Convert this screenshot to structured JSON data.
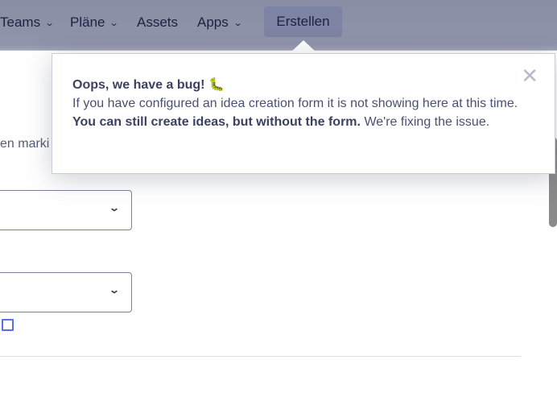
{
  "nav": {
    "items": [
      {
        "label": "Teams",
        "chevron": "chevron-down-icon"
      },
      {
        "label": "Pläne",
        "chevron": "chevron-down-icon"
      },
      {
        "label": "Assets"
      },
      {
        "label": "Apps",
        "chevron": "chevron-down-icon"
      }
    ],
    "create_label": "Erstellen"
  },
  "background": {
    "partial_text": "en marki"
  },
  "popover": {
    "title": "Oops, we have a bug!",
    "icon": "bug-icon",
    "text_1": "If you have configured an idea creation form it is not showing here at this time.",
    "text_bold": "You can still create ideas, but without the form.",
    "text_2": "We're fixing the issue.",
    "close_symbol": "✕"
  },
  "colors": {
    "header": "#8e92a8",
    "link": "#5b6ef0"
  }
}
